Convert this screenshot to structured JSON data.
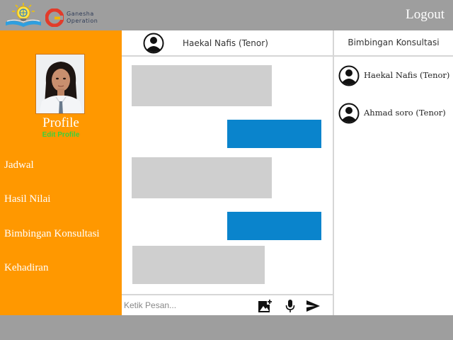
{
  "header": {
    "brand_line1": "Ganesha",
    "brand_line2": "Operation",
    "logout_label": "Logout"
  },
  "sidebar": {
    "profile_title": "Profile",
    "edit_profile_label": "Edit Profile",
    "menu": [
      {
        "label": "Jadwal"
      },
      {
        "label": "Hasil Nilai"
      },
      {
        "label": "Bimbingan Konsultasi"
      },
      {
        "label": "Kehadiran"
      }
    ]
  },
  "chat": {
    "contact_name": "Haekal Nafis (Tenor)",
    "message_input_placeholder": "Ketik Pesan...",
    "messages": [
      {
        "direction": "incoming"
      },
      {
        "direction": "outgoing"
      },
      {
        "direction": "incoming"
      },
      {
        "direction": "outgoing"
      },
      {
        "direction": "incoming"
      }
    ]
  },
  "contacts_panel": {
    "title": "Bimbingan Konsultasi",
    "contacts": [
      {
        "name": "Haekal Nafis (Tenor)"
      },
      {
        "name": "Ahmad soro (Tenor)"
      }
    ]
  },
  "colors": {
    "sidebar": "#ff9800",
    "outgoing_bubble": "#0a84cc",
    "incoming_bubble": "#cfcfcf",
    "topbar": "#9e9e9e"
  }
}
